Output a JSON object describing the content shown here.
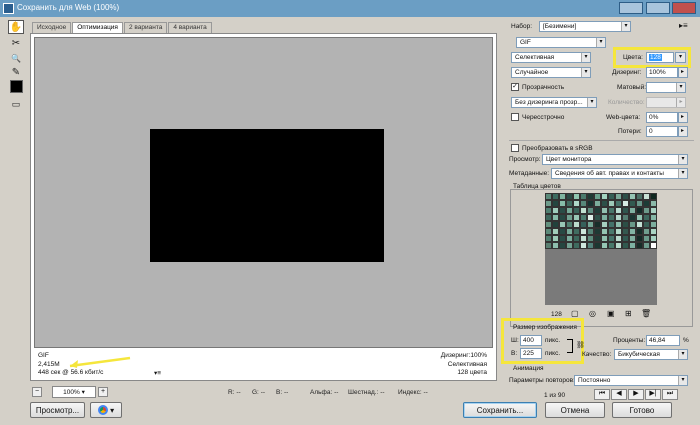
{
  "window": {
    "title": "Сохранить для Web (100%)"
  },
  "tabs": [
    "Исходное",
    "Оптимизация",
    "2 варианта",
    "4 варианта"
  ],
  "tools": [
    {
      "icon": "hand-icon",
      "glyph": "✋"
    },
    {
      "icon": "slice-select-icon",
      "glyph": "✂"
    },
    {
      "icon": "zoom-icon",
      "glyph": "🔍"
    },
    {
      "icon": "eyedropper-icon",
      "glyph": "✎"
    }
  ],
  "canvas_info": {
    "format": "GIF",
    "size": "2,415M",
    "time": "448 сек @ 56.6 кбит/с",
    "dither": "Дизеринг:100%",
    "palette": "Селективная",
    "colors": "128 цвета"
  },
  "statusbar": {
    "zoom": "100%",
    "r": "R:",
    "r_value": "--",
    "g": "G:",
    "g_value": "--",
    "b": "B:",
    "b_value": "--",
    "alpha": "Альфа:",
    "alpha_value": "--",
    "hex": "Шестнад.:",
    "hex_value": "--",
    "index": "Индекс:",
    "index_value": "--"
  },
  "buttons": {
    "preview": "Просмотр...",
    "save": "Сохранить...",
    "cancel": "Отмена",
    "done": "Готово"
  },
  "panel": {
    "preset_label": "Набор:",
    "preset_value": "[Безимени]",
    "format": "GIF",
    "reduction": "Селективная",
    "colors_label": "Цвета:",
    "colors_value": "128",
    "dither_algo": "Случайное",
    "dither_label": "Дизеринг:",
    "dither_value": "100%",
    "transparency_label": "Прозрачность",
    "transparency_checked": true,
    "matte_label": "Матовый:",
    "transparency_dither": "Без дизеринга прозр...",
    "amount_label": "Количество:",
    "interlaced_label": "Чересстрочно",
    "webcolors_label": "Web-цвета:",
    "webcolors_value": "0%",
    "lossy_label": "Потери:",
    "lossy_value": "0",
    "srgb_label": "Преобразовать в sRGB",
    "preview_label": "Просмотр:",
    "preview_value": "Цвет монитора",
    "metadata_label": "Метаданные:",
    "metadata_value": "Сведения об авт. правах и контакты",
    "color_table_title": "Таблица цветов",
    "color_count": "128",
    "image_size_title": "Размер изображения",
    "width_label": "Ш:",
    "width_value": "400",
    "height_label": "В:",
    "height_value": "225",
    "unit": "пикс.",
    "percent_label": "Проценты:",
    "percent_value": "46,84",
    "percent_sign": "%",
    "quality_label": "Качество:",
    "quality_value": "Бикубическая",
    "animation_title": "Анимация",
    "loop_label": "Параметры повторов:",
    "loop_value": "Постоянно",
    "frame_counter": "1 из 90"
  },
  "colors": {
    "accent_highlight": "#f5e63c",
    "titlebar": "#6b9ec4",
    "canvas_bg": "#b3b3b3",
    "image": "#000000",
    "selected_field": "#3399ff"
  },
  "color_table_swatches": [
    "#5b8a7a",
    "#3d6b60",
    "#7fb5a0",
    "#2a4a44",
    "#8fc6b0",
    "#4b7a6c",
    "#1f3a34",
    "#6aa08c",
    "#a4d4c0",
    "#355e55",
    "#7aa898",
    "#2e4f48",
    "#95c4b2",
    "#4a6f64",
    "#c8e0d4",
    "#102820",
    "#6e9c8c",
    "#244640",
    "#86bca8",
    "#3f6a5e",
    "#b0d8c8",
    "#58887a",
    "#183430",
    "#7cae9c",
    "#2c5048",
    "#9ccab8",
    "#46746a",
    "#d8ece4",
    "#325a50",
    "#68988a",
    "#1c3c36",
    "#8ab8a8",
    "#4e7e70",
    "#a0ccbc",
    "#2a4c46",
    "#76aa98",
    "#3a645a",
    "#c0e0d0",
    "#5e8e80",
    "#203e38",
    "#92c0b0",
    "#48766a",
    "#b8dcd0",
    "#30564e",
    "#80b2a2",
    "#142c28",
    "#6c9a8a",
    "#a8d2c4",
    "#3c665c",
    "#88baa8",
    "#264842",
    "#70a090",
    "#9ac8b6",
    "#4c7c6e",
    "#e0f0e8",
    "#2e5249",
    "#7eb0a0",
    "#426e62",
    "#b4d6ca",
    "#567e72",
    "#1a3632",
    "#90c2b0",
    "#3e685e",
    "#84b6a6",
    "#62907e",
    "#22423c",
    "#98c6b4",
    "#50806f",
    "#bcdccc",
    "#36605a",
    "#74a696",
    "#182e2a",
    "#a6d0c0",
    "#44726a",
    "#8cbcac",
    "#2c4e46",
    "#6a9888",
    "#c4e2d6",
    "#3a6258",
    "#7cae9e",
    "#5a8878",
    "#a2ceba",
    "#284a44",
    "#78ac9a",
    "#406c60",
    "#cce6da",
    "#548476",
    "#1e3a34",
    "#94c4b2",
    "#4a786c",
    "#b2d8c8",
    "#34584f",
    "#82b4a4",
    "#162e29",
    "#709e8e",
    "#aad4c4",
    "#4e7c6e",
    "#9ccab6",
    "#2a4e47",
    "#7aac9c",
    "#3c685c",
    "#c2e0d2",
    "#5c8c7c",
    "#203c36",
    "#90c0ae",
    "#46746a",
    "#bad8cc",
    "#325a52",
    "#80b0a0",
    "#142a26",
    "#6a9a8a",
    "#a4d0c0",
    "#587e70",
    "#8ebeae",
    "#264640",
    "#72a292",
    "#3e6a5e",
    "#d0e8de",
    "#52827a",
    "#1c3832",
    "#96c6b4",
    "#48786a",
    "#b6dacc",
    "#30584e",
    "#7eb2a2",
    "#182c28",
    "#6e9c8e",
    "#ffffff"
  ]
}
